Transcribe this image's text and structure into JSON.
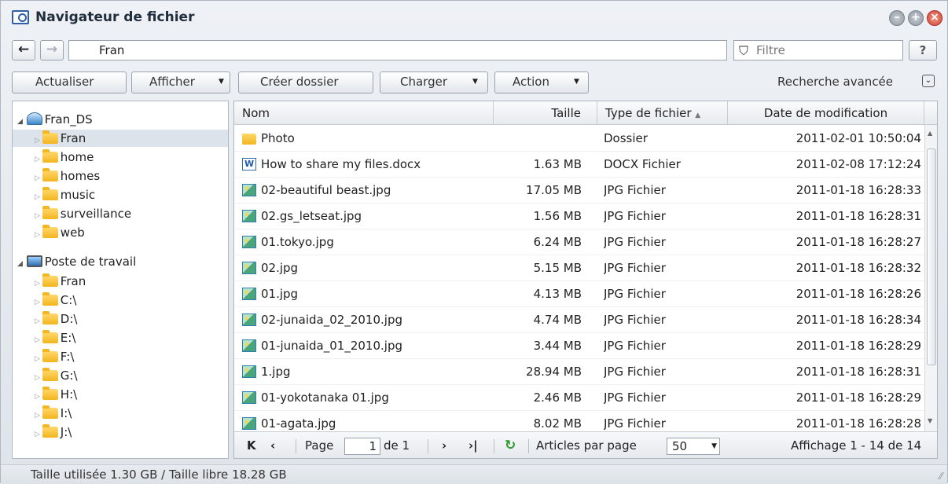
{
  "window": {
    "title": "Navigateur de fichier"
  },
  "address": {
    "path": "Fran",
    "filter_placeholder": "Filtre",
    "help": "?"
  },
  "toolbar": {
    "refresh": "Actualiser",
    "view": "Afficher",
    "create_folder": "Créer dossier",
    "upload": "Charger",
    "action": "Action",
    "advanced_search": "Recherche avancée"
  },
  "tree": {
    "nas": {
      "label": "Fran_DS",
      "children": [
        "Fran",
        "home",
        "homes",
        "music",
        "surveillance",
        "web"
      ]
    },
    "pc": {
      "label": "Poste de travail",
      "children": [
        "Fran",
        "C:\\",
        "D:\\",
        "E:\\",
        "F:\\",
        "G:\\",
        "H:\\",
        "I:\\",
        "J:\\"
      ]
    }
  },
  "columns": {
    "name": "Nom",
    "size": "Taille",
    "type": "Type de fichier",
    "date": "Date de modification"
  },
  "files": [
    {
      "name": "Photo",
      "size": "",
      "type": "Dossier",
      "date": "2011-02-01 10:50:04",
      "icon": "folder-icon"
    },
    {
      "name": "How to share my files.docx",
      "size": "1.63 MB",
      "type": "DOCX Fichier",
      "date": "2011-02-08 17:12:24",
      "icon": "word-doc-icon"
    },
    {
      "name": "02-beautiful beast.jpg",
      "size": "17.05 MB",
      "type": "JPG Fichier",
      "date": "2011-01-18 16:28:33",
      "icon": "image-file-icon"
    },
    {
      "name": "02.gs_letseat.jpg",
      "size": "1.56 MB",
      "type": "JPG Fichier",
      "date": "2011-01-18 16:28:31",
      "icon": "image-file-icon"
    },
    {
      "name": "01.tokyo.jpg",
      "size": "6.24 MB",
      "type": "JPG Fichier",
      "date": "2011-01-18 16:28:27",
      "icon": "image-file-icon"
    },
    {
      "name": "02.jpg",
      "size": "5.15 MB",
      "type": "JPG Fichier",
      "date": "2011-01-18 16:28:32",
      "icon": "image-file-icon"
    },
    {
      "name": "01.jpg",
      "size": "4.13 MB",
      "type": "JPG Fichier",
      "date": "2011-01-18 16:28:26",
      "icon": "image-file-icon"
    },
    {
      "name": "02-junaida_02_2010.jpg",
      "size": "4.74 MB",
      "type": "JPG Fichier",
      "date": "2011-01-18 16:28:34",
      "icon": "image-file-icon"
    },
    {
      "name": "01-junaida_01_2010.jpg",
      "size": "3.44 MB",
      "type": "JPG Fichier",
      "date": "2011-01-18 16:28:29",
      "icon": "image-file-icon"
    },
    {
      "name": "1.jpg",
      "size": "28.94 MB",
      "type": "JPG Fichier",
      "date": "2011-01-18 16:28:31",
      "icon": "image-file-icon"
    },
    {
      "name": "01-yokotanaka 01.jpg",
      "size": "2.46 MB",
      "type": "JPG Fichier",
      "date": "2011-01-18 16:28:29",
      "icon": "image-file-icon"
    },
    {
      "name": "01-agata.jpg",
      "size": "8.02 MB",
      "type": "JPG Fichier",
      "date": "2011-01-18 16:28:28",
      "icon": "image-file-icon"
    }
  ],
  "pager": {
    "page_label": "Page",
    "page_value": "1",
    "of_label": "de 1",
    "per_page_label": "Articles par page",
    "per_page_value": "50",
    "display": "Affichage 1 - 14 de 14"
  },
  "status": {
    "text": "Taille utilisée 1.30 GB / Taille libre 18.28 GB"
  },
  "colors": {
    "close": "#d0402c",
    "folder": "#f2b620",
    "refresh_green": "#2e9a2e"
  }
}
